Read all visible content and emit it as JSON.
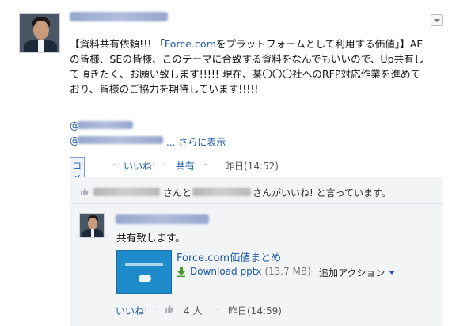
{
  "post": {
    "body_pre": "【資料共有依頼!!! 「",
    "body_link": "Force.com",
    "body_post": "をプラットフォームとして利用する価値」】AEの皆様、SEの皆様、このテーマに合致する資料をなんでもいいので、Up共有して頂きたく、お願い致します!!!!! 現在、某〇〇〇社へのRFP対応作業を進めており、皆様のご協力を期待しています!!!!!",
    "mention_1": "@",
    "mention_2": "@",
    "more_link": "... さらに表示"
  },
  "actions": {
    "comment": "コメント",
    "like": "いいね!",
    "share": "共有",
    "timestamp": "昨日(14:52)",
    "separator": "·"
  },
  "likes": {
    "text_1": "さんと",
    "text_2": "さんがいいね! と言っています。"
  },
  "comment": {
    "text": "共有致します。",
    "file_title": "Force.com価値まとめ",
    "download": "Download pptx",
    "file_size": "(13.7 MB)",
    "add_action": "追加アクション",
    "like": "いいね!",
    "like_count": "4 人",
    "timestamp": "昨日(14:59)"
  }
}
